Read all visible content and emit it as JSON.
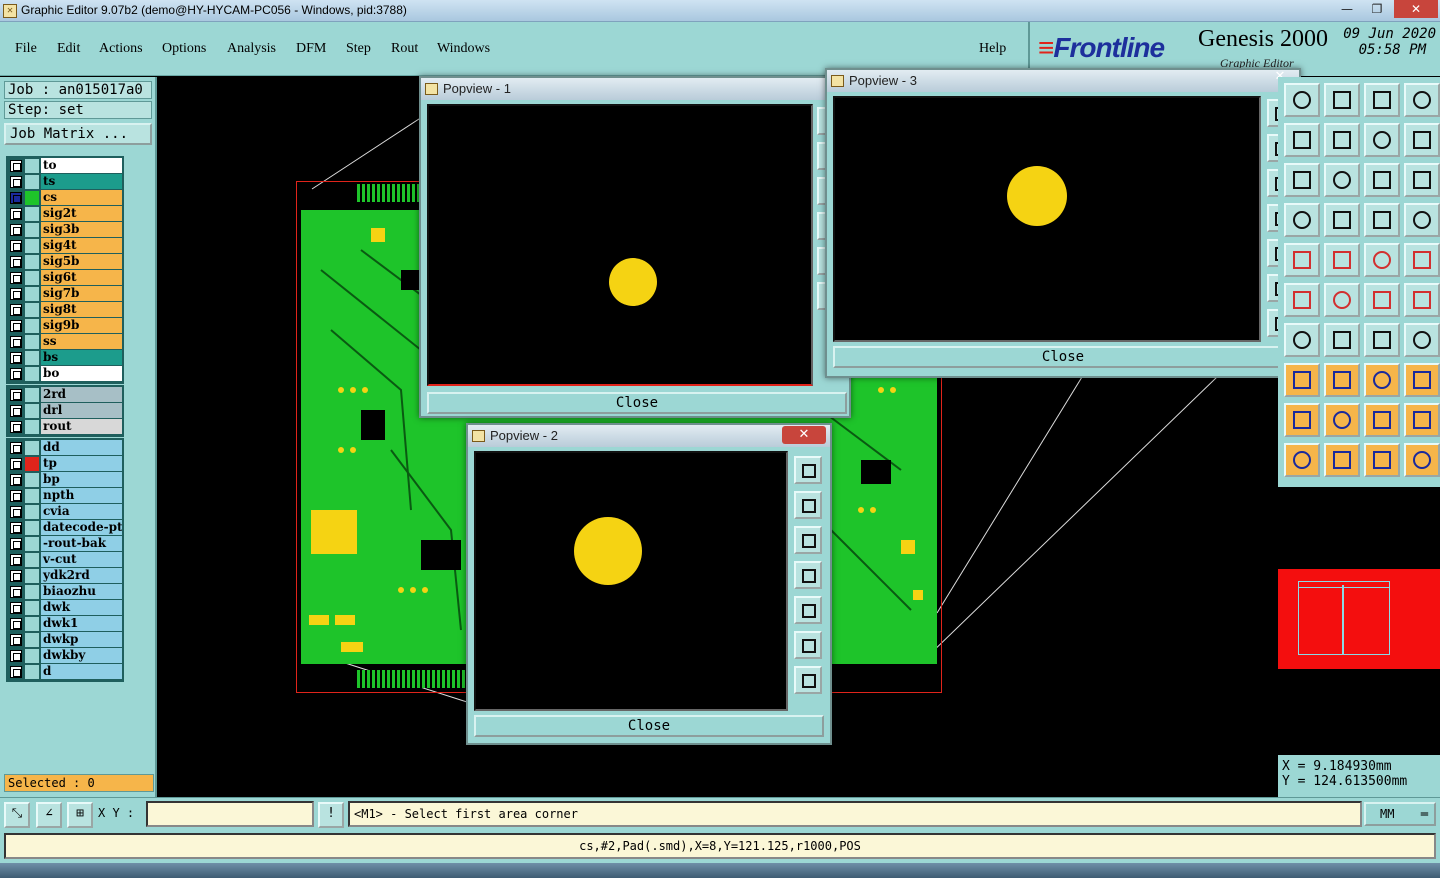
{
  "window": {
    "title": "Graphic Editor 9.07b2 (demo@HY-HYCAM-PC056 - Windows, pid:3788)",
    "minimize": "—",
    "maximize": "❐",
    "close": "✕"
  },
  "menu": {
    "items": [
      "File",
      "Edit",
      "Actions",
      "Options",
      "Analysis",
      "DFM",
      "Step",
      "Rout",
      "Windows"
    ],
    "help": "Help"
  },
  "brand": {
    "logo": "Frontline",
    "product": "Genesis 2000",
    "subtitle": "Graphic Editor",
    "date": "09 Jun 2020",
    "time": "05:58 PM"
  },
  "job": {
    "job_label": "Job : an015017a0",
    "step_label": "Step: set",
    "matrix_button": "Job Matrix ..."
  },
  "layers": {
    "group1": [
      {
        "name": "to",
        "color": "#ffffff"
      },
      {
        "name": "ts",
        "color": "#1c9c8c"
      },
      {
        "name": "cs",
        "color": "#f6b54a",
        "mark": "#1ec42a",
        "active": true
      },
      {
        "name": "sig2t",
        "color": "#f6b54a"
      },
      {
        "name": "sig3b",
        "color": "#f6b54a"
      },
      {
        "name": "sig4t",
        "color": "#f6b54a"
      },
      {
        "name": "sig5b",
        "color": "#f6b54a"
      },
      {
        "name": "sig6t",
        "color": "#f6b54a"
      },
      {
        "name": "sig7b",
        "color": "#f6b54a"
      },
      {
        "name": "sig8t",
        "color": "#f6b54a"
      },
      {
        "name": "sig9b",
        "color": "#f6b54a"
      },
      {
        "name": "ss",
        "color": "#f6b54a"
      },
      {
        "name": "bs",
        "color": "#1c9c8c"
      },
      {
        "name": "bo",
        "color": "#ffffff"
      }
    ],
    "group2": [
      {
        "name": "2rd",
        "color": "#a7bfc6"
      },
      {
        "name": "drl",
        "color": "#a7bfc6"
      },
      {
        "name": "rout",
        "color": "#d8d8d8"
      }
    ],
    "group3": [
      {
        "name": "dd",
        "color": "#8fcfe6"
      },
      {
        "name": "tp",
        "color": "#8fcfe6",
        "mark": "#e0241b"
      },
      {
        "name": "bp",
        "color": "#8fcfe6"
      },
      {
        "name": "npth",
        "color": "#8fcfe6"
      },
      {
        "name": "cvia",
        "color": "#8fcfe6"
      },
      {
        "name": "datecode-ptc",
        "color": "#8fcfe6"
      },
      {
        "name": "-rout-bak",
        "color": "#8fcfe6"
      },
      {
        "name": "v-cut",
        "color": "#8fcfe6"
      },
      {
        "name": "ydk2rd",
        "color": "#8fcfe6"
      },
      {
        "name": "biaozhu",
        "color": "#8fcfe6"
      },
      {
        "name": "dwk",
        "color": "#8fcfe6"
      },
      {
        "name": "dwk1",
        "color": "#8fcfe6"
      },
      {
        "name": "dwkp",
        "color": "#8fcfe6"
      },
      {
        "name": "dwkby",
        "color": "#8fcfe6"
      },
      {
        "name": "d",
        "color": "#8fcfe6"
      }
    ]
  },
  "selected": "Selected : 0",
  "popviews": {
    "p1": {
      "title": "Popview - 1",
      "close": "Close",
      "x_label": "✕"
    },
    "p2": {
      "title": "Popview - 2",
      "close": "Close",
      "x_label": "✕"
    },
    "p3": {
      "title": "Popview - 3",
      "close": "Close",
      "x_label": "✕"
    }
  },
  "coords": {
    "x": "X = 9.184930mm",
    "y": "Y = 124.613500mm"
  },
  "status": {
    "xy_label": "X Y :",
    "xy_value": "",
    "alert": "!",
    "prompt": "<M1> - Select first area corner",
    "units": "MM",
    "info": "cs,#2,Pad(.smd),X=8,Y=121.125,r1000,POS"
  },
  "colors": {
    "panel": "#9cd7d4",
    "pad": "#f5d313",
    "board": "#1ec42a",
    "outline": "#e0241b"
  }
}
